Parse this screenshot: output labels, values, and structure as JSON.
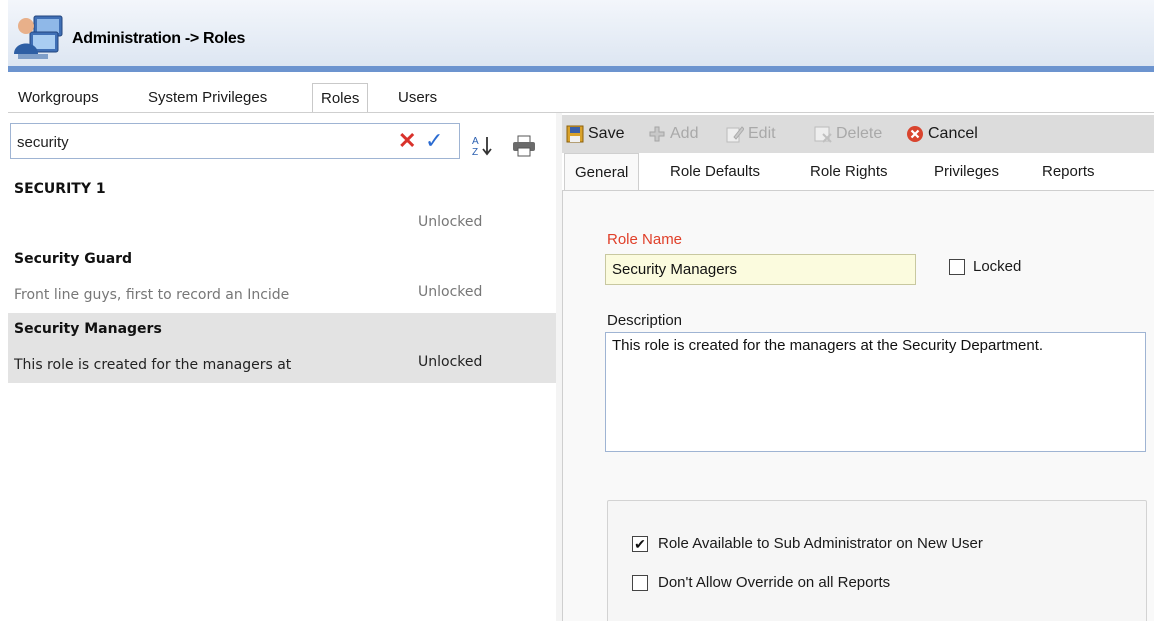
{
  "window": {
    "title": "Administration -> Roles"
  },
  "main_tabs": [
    {
      "label": "Workgroups",
      "active": false
    },
    {
      "label": "System Privileges",
      "active": false
    },
    {
      "label": "Roles",
      "active": true
    },
    {
      "label": "Users",
      "active": false
    }
  ],
  "search": {
    "value": "security"
  },
  "roles": [
    {
      "name": "SECURITY 1",
      "description": "",
      "status": "Unlocked",
      "selected": false
    },
    {
      "name": "Security Guard",
      "description": "Front line guys, first to record an Incide",
      "status": "Unlocked",
      "selected": false
    },
    {
      "name": "Security Managers",
      "description": "This role is created for the managers at",
      "status": "Unlocked",
      "selected": true
    }
  ],
  "toolbar": {
    "save": "Save",
    "add": "Add",
    "edit": "Edit",
    "delete": "Delete",
    "cancel": "Cancel"
  },
  "sub_tabs": [
    {
      "label": "General",
      "active": true
    },
    {
      "label": "Role Defaults",
      "active": false
    },
    {
      "label": "Role Rights",
      "active": false
    },
    {
      "label": "Privileges",
      "active": false
    },
    {
      "label": "Reports",
      "active": false
    }
  ],
  "form": {
    "role_name_label": "Role Name",
    "role_name_value": "Security Managers",
    "locked_label": "Locked",
    "locked_checked": false,
    "description_label": "Description",
    "description_value": "This role is created for the managers at the Security Department.",
    "option_sub_admin_label": "Role Available to Sub Administrator on New User",
    "option_sub_admin_checked": true,
    "option_no_override_label": "Don't Allow Override on all Reports",
    "option_no_override_checked": false
  },
  "colors": {
    "title_accent": "#6c94cf",
    "required_label": "#e0402a",
    "selected_row": "#e3e3e3",
    "clear_icon": "#d9322b",
    "apply_icon": "#2a6bd1"
  },
  "icons": [
    "admin-users-icon",
    "clear-icon",
    "apply-check-icon",
    "sort-az-icon",
    "print-icon",
    "save-icon",
    "add-icon",
    "edit-icon",
    "delete-icon",
    "cancel-icon"
  ]
}
